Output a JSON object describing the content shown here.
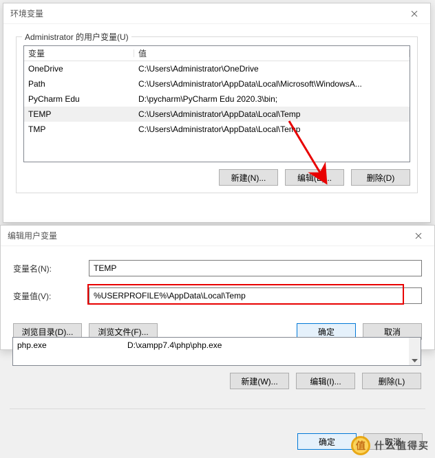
{
  "env_dialog": {
    "title": "环境变量",
    "group_label": "Administrator 的用户变量(U)",
    "headers": {
      "var": "变量",
      "val": "值"
    },
    "rows": [
      {
        "var": "OneDrive",
        "val": "C:\\Users\\Administrator\\OneDrive"
      },
      {
        "var": "Path",
        "val": "C:\\Users\\Administrator\\AppData\\Local\\Microsoft\\WindowsA..."
      },
      {
        "var": "PyCharm Edu",
        "val": "D:\\pycharm\\PyCharm Edu 2020.3\\bin;"
      },
      {
        "var": "TEMP",
        "val": "C:\\Users\\Administrator\\AppData\\Local\\Temp"
      },
      {
        "var": "TMP",
        "val": "C:\\Users\\Administrator\\AppData\\Local\\Temp"
      }
    ],
    "buttons": {
      "new": "新建(N)...",
      "edit": "编辑(E)...",
      "del": "删除(D)"
    }
  },
  "edit_dialog": {
    "title": "编辑用户变量",
    "name_label": "变量名(N):",
    "name_value": "TEMP",
    "value_label": "变量值(V):",
    "value_value": "%USERPROFILE%\\AppData\\Local\\Temp",
    "browse_dir": "浏览目录(D)...",
    "browse_file": "浏览文件(F)...",
    "ok": "确定",
    "cancel": "取消"
  },
  "sys_vars": {
    "row": {
      "var": "php.exe",
      "val": "D:\\xampp7.4\\php\\php.exe"
    },
    "buttons": {
      "new": "新建(W)...",
      "edit": "编辑(I)...",
      "del": "删除(L)"
    },
    "ok": "确定",
    "cancel": "取消"
  },
  "watermark": "什么值得买"
}
